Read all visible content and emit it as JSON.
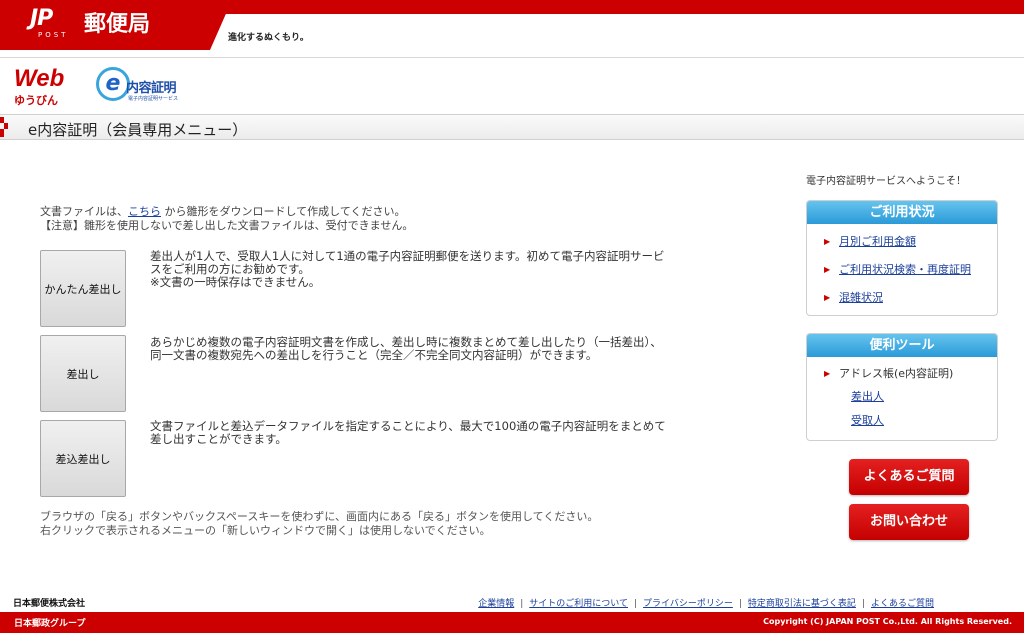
{
  "header": {
    "logo_mark": "JP",
    "logo_sub": "POST",
    "brand_name": "郵便局",
    "tagline": "進化するぬくもり。"
  },
  "service": {
    "web_logo": "Web",
    "yupack": "ゆうびん",
    "e_mark": "e",
    "e_name": "内容証明",
    "e_sub": "電子内容証明サービス"
  },
  "page": {
    "title": "e内容証明（会員専用メニュー）"
  },
  "intro": {
    "line1_before": "文書ファイルは、",
    "link": "こちら",
    "line1_after": " から雛形をダウンロードして作成してください。",
    "line2": "【注意】雛形を使用しないで差し出した文書ファイルは、受付できません。"
  },
  "options": [
    {
      "label": "かんたん差出し",
      "desc": "差出人が1人で、受取人1人に対して1通の電子内容証明郵便を送ります。初めて電子内容証明サービスをご利用の方にお勧めです。\n※文書の一時保存はできません。"
    },
    {
      "label": "差出し",
      "desc": "あらかじめ複数の電子内容証明文書を作成し、差出し時に複数まとめて差し出したり（一括差出）、同一文書の複数宛先への差出しを行うこと（完全／不完全同文内容証明）ができます。"
    },
    {
      "label": "差込差出し",
      "desc": "文書ファイルと差込データファイルを指定することにより、最大で100通の電子内容証明をまとめて差し出すことができます。"
    }
  ],
  "note": {
    "line1": "ブラウザの「戻る」ボタンやバックスペースキーを使わずに、画面内にある「戻る」ボタンを使用してください。",
    "line2": "右クリックで表示されるメニューの「新しいウィンドウで開く」は使用しないでください。"
  },
  "sidebar": {
    "welcome": "電子内容証明サービスへようこそ！",
    "usage": {
      "title": "ご利用状況",
      "items": [
        "月別ご利用金額",
        "ご利用状況検索・再度証明",
        "混雑状況"
      ]
    },
    "tools": {
      "title": "便利ツール",
      "address_book": "アドレス帳(e内容証明)",
      "sub_items": [
        "差出人",
        "受取人"
      ]
    },
    "faq_button": "よくあるご質問",
    "contact_button": "お問い合わせ"
  },
  "footer": {
    "company": "日本郵便株式会社",
    "links": [
      "企業情報",
      "サイトのご利用について",
      "プライバシーポリシー",
      "特定商取引法に基づく表記",
      "よくあるご質問"
    ],
    "group": "日本郵政グループ",
    "copyright": "Copyright (C) JAPAN POST Co.,Ltd.  All Rights Reserved."
  },
  "colors": {
    "brand_red": "#cc0000",
    "panel_blue": "#2a9ad8",
    "link_blue": "#1b3f9a"
  }
}
